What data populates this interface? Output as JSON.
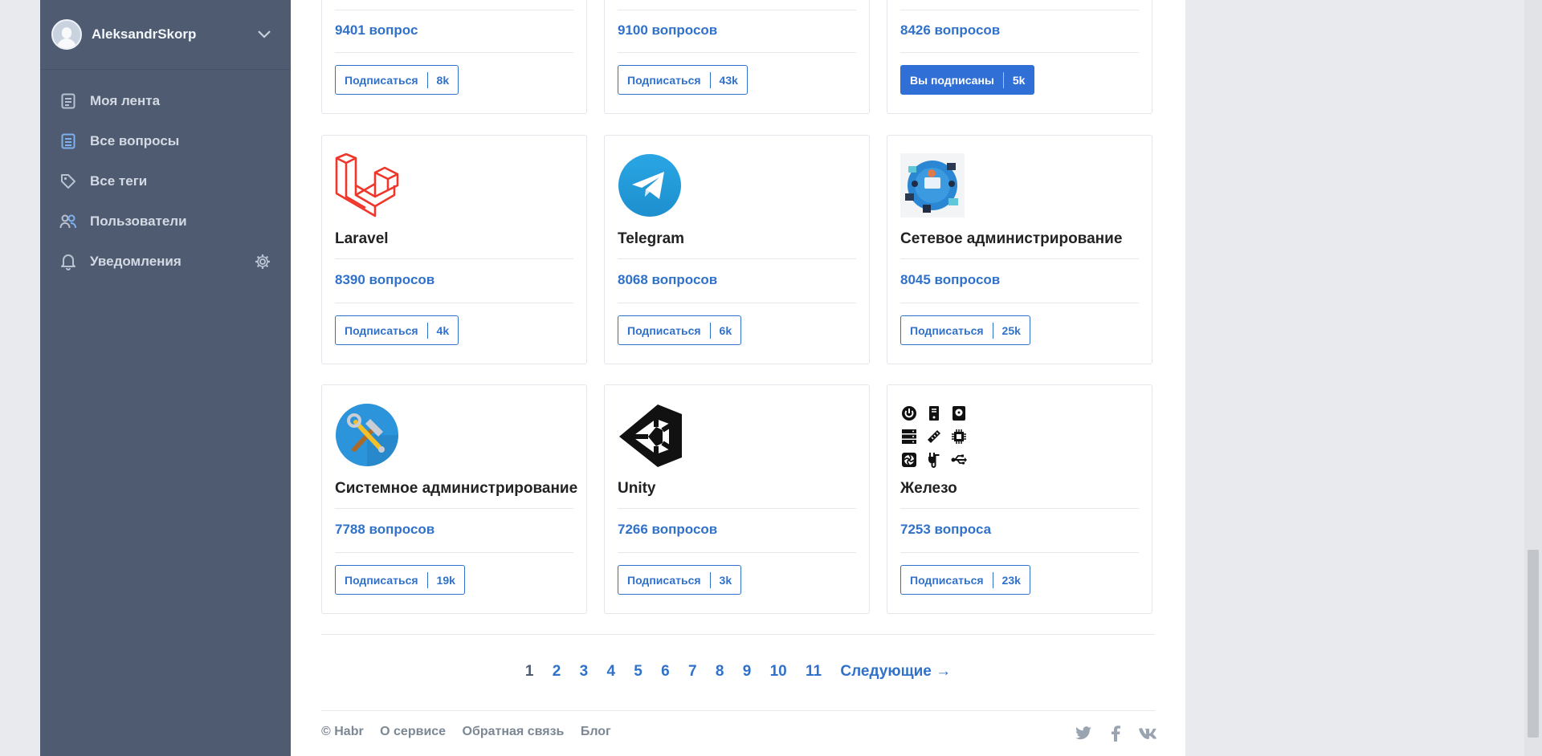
{
  "user": {
    "name": "AleksandrSkorp"
  },
  "nav": [
    {
      "label": "Моя лента",
      "icon": "feed-icon"
    },
    {
      "label": "Все вопросы",
      "icon": "questions-icon"
    },
    {
      "label": "Все теги",
      "icon": "tag-icon"
    },
    {
      "label": "Пользователи",
      "icon": "users-icon"
    },
    {
      "label": "Уведомления",
      "icon": "bell-icon"
    }
  ],
  "top_row": [
    {
      "count": "9401 вопрос",
      "sub_label": "Подписаться",
      "subs": "8k",
      "subscribed": false
    },
    {
      "count": "9100 вопросов",
      "sub_label": "Подписаться",
      "subs": "43k",
      "subscribed": false
    },
    {
      "count": "8426 вопросов",
      "sub_label": "Вы подписаны",
      "subs": "5k",
      "subscribed": true
    }
  ],
  "tags": [
    {
      "name": "Laravel",
      "count": "8390 вопросов",
      "sub_label": "Подписаться",
      "subs": "4k",
      "logo": "laravel-logo-icon"
    },
    {
      "name": "Telegram",
      "count": "8068 вопросов",
      "sub_label": "Подписаться",
      "subs": "6k",
      "logo": "telegram-logo-icon"
    },
    {
      "name": "Сетевое администрирование",
      "count": "8045 вопросов",
      "sub_label": "Подписаться",
      "subs": "25k",
      "logo": "network-admin-image"
    },
    {
      "name": "Системное администрирование",
      "count": "7788 вопросов",
      "sub_label": "Подписаться",
      "subs": "19k",
      "logo": "sysadmin-tools-icon"
    },
    {
      "name": "Unity",
      "count": "7266 вопросов",
      "sub_label": "Подписаться",
      "subs": "3k",
      "logo": "unity-logo-icon"
    },
    {
      "name": "Железо",
      "count": "7253 вопроса",
      "sub_label": "Подписаться",
      "subs": "23k",
      "logo": "hardware-icons-grid"
    }
  ],
  "pagination": {
    "pages": [
      "1",
      "2",
      "3",
      "4",
      "5",
      "6",
      "7",
      "8",
      "9",
      "10",
      "11"
    ],
    "current": "1",
    "next": "Следующие →"
  },
  "footer": {
    "copyright": "© Habr",
    "links": [
      "О сервисе",
      "Обратная связь",
      "Блог"
    ]
  },
  "colors": {
    "sidebar": "#4e5b70",
    "accent": "#3071c9",
    "subscribed": "#2f6fd6"
  }
}
